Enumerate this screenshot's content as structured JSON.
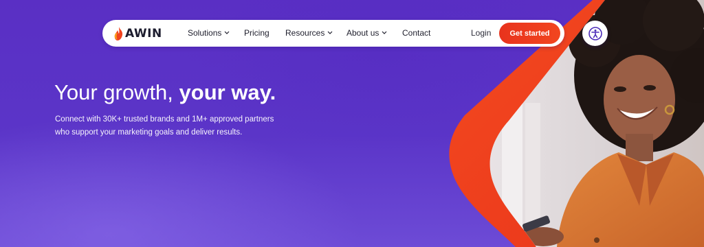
{
  "brand": {
    "name": "AWIN",
    "logo_icon": "flame-logo-icon"
  },
  "nav": {
    "items": [
      {
        "label": "Solutions",
        "dropdown": true
      },
      {
        "label": "Pricing",
        "dropdown": false
      },
      {
        "label": "Resources",
        "dropdown": true
      },
      {
        "label": "About us",
        "dropdown": true
      },
      {
        "label": "Contact",
        "dropdown": false
      }
    ],
    "login_label": "Login",
    "cta_label": "Get started"
  },
  "accessibility_button": {
    "icon": "accessibility-icon"
  },
  "hero": {
    "title_regular": "Your growth, ",
    "title_bold": "your way.",
    "subtitle_line1": "Connect with 30K+ trusted brands and 1M+ approved partners",
    "subtitle_line2": "who support your marketing goals and deliver results."
  },
  "colors": {
    "background": "#5b33c6",
    "accent": "#ee3d1f",
    "navbar": "#ffffff",
    "text_light": "#ffffff",
    "text_dark": "#1d1d2b"
  }
}
